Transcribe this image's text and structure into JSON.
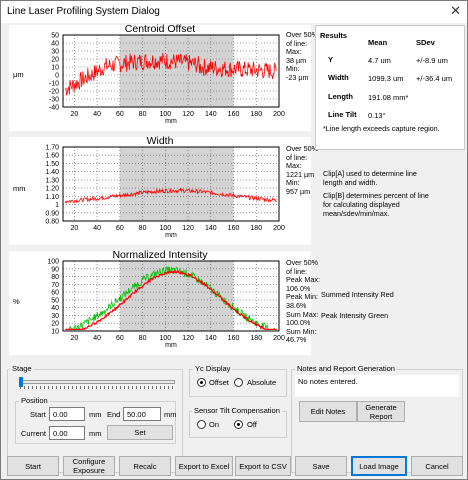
{
  "window": {
    "title": "Line Laser Profiling System Dialog",
    "close_glyph": "✕"
  },
  "colors": {
    "red": "#ff0000",
    "green": "#00c000",
    "clip": "#d3d3d3"
  },
  "plots": {
    "centroid": {
      "title": "Centroid Offset",
      "unit": "µm",
      "stat": "Over 50%\nof line:\nMax:\n38 µm\nMin:\n-23 µm",
      "yticks": [
        "50",
        "40",
        "30",
        "20",
        "10",
        "0",
        "-10",
        "-20",
        "-30",
        "-40"
      ],
      "xticks": [
        "20",
        "40",
        "60",
        "80",
        "100",
        "120",
        "140",
        "160",
        "180",
        "200"
      ],
      "xlabel": "mm"
    },
    "width": {
      "title": "Width",
      "unit": "mm",
      "stat": "Over 50%\nof line:\nMax:\n1221 µm\nMin:\n957 µm",
      "yticks": [
        "1.70",
        "1.60",
        "1.50",
        "1.40",
        "1.30",
        "1.20",
        "1.10",
        "1",
        "0.90",
        "0.80"
      ],
      "xticks": [
        "20",
        "40",
        "60",
        "80",
        "100",
        "120",
        "140",
        "160",
        "180",
        "200"
      ],
      "xlabel": "mm"
    },
    "intensity": {
      "title": "Normalized Intensity",
      "unit": "%",
      "stat": "Over 50%\nof line:\nPeak Max:\n106.0%\nPeak Min:\n38.6%\nSum Max:\n100.0%\nSum Min:\n46.7%",
      "yticks": [
        "100",
        "90",
        "80",
        "70",
        "60",
        "50",
        "40",
        "30",
        "20",
        "10"
      ],
      "xticks": [
        "20",
        "40",
        "60",
        "80",
        "100",
        "120",
        "140",
        "160",
        "180",
        "200"
      ],
      "xlabel": "mm"
    }
  },
  "results": {
    "title": "Results",
    "col_mean": "Mean",
    "col_sdev": "SDev",
    "rows": [
      {
        "label": "Y",
        "mean": "4.7 um",
        "sdev": "+/-8.9 um"
      },
      {
        "label": "Width",
        "mean": "1099.3 um",
        "sdev": "+/-36.4 um"
      },
      {
        "label": "Length",
        "mean": "191.08 mm*",
        "sdev": ""
      },
      {
        "label": "Line Tilt",
        "mean": "0.13°",
        "sdev": ""
      }
    ],
    "footnote": "*Line length exceeds capture region."
  },
  "notes": {
    "clip_a": "Clip[A] used to determine line\nlength and width.",
    "clip_b": "Clip[B] determines percent of line\nfor calculating displayed\nmean/sdev/min/max.",
    "legend_red": "Summed Intensity Red",
    "legend_green": "Peak Intensity Green"
  },
  "stage": {
    "label": "Stage",
    "position_label": "Position",
    "start_label": "Start",
    "start_value": "0.00",
    "start_unit": "mm",
    "end_label": "End",
    "end_value": "50.00",
    "end_unit": "mm",
    "current_label": "Current",
    "current_value": "0.00",
    "current_unit": "mm",
    "set_button": "Set"
  },
  "yc_display": {
    "label": "Yc Display",
    "offset": "Offset",
    "absolute": "Absolute",
    "selected": "Offset"
  },
  "tilt": {
    "label": "Sensor Tilt Compensation",
    "on": "On",
    "off": "Off",
    "selected": "Off"
  },
  "report": {
    "label": "Notes and Report Generation",
    "text": "No notes entered.",
    "edit_button": "Edit Notes",
    "generate_button": "Generate\nReport"
  },
  "buttons": {
    "start": "Start",
    "configure": "Configure\nExposure",
    "recalc": "Recalc",
    "export_excel": "Export to Excel",
    "export_csv": "Export to CSV",
    "save": "Save",
    "load_image": "Load Image",
    "cancel": "Cancel"
  }
}
